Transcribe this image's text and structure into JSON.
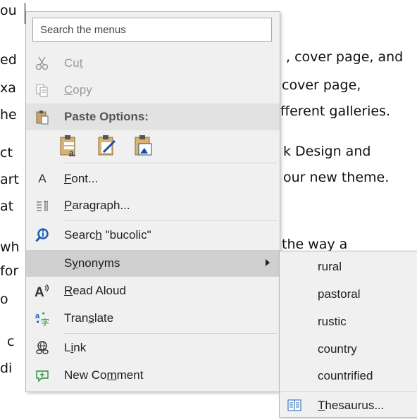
{
  "document": {
    "lines": [
      {
        "left": "|",
        "right": ""
      },
      {
        "left": "ed",
        "right": ", cover page, and"
      },
      {
        "left": "xa",
        "right": "cover page,"
      },
      {
        "left": "he",
        "right": "fferent galleries."
      },
      {
        "left": "ct",
        "right": "k Design and"
      },
      {
        "left": "art",
        "right": "our new theme."
      },
      {
        "left": "at",
        "right": ""
      },
      {
        "left": "wh",
        "right": "the way a"
      },
      {
        "left": "for",
        "right": ""
      },
      {
        "left": "o",
        "right": ""
      },
      {
        "left": "c",
        "right": ""
      },
      {
        "left": "di",
        "right": ""
      }
    ],
    "top_fragment": "ou"
  },
  "menu": {
    "search_placeholder": "Search the menus",
    "cut": {
      "pre": "Cu",
      "u": "t",
      "post": ""
    },
    "copy": {
      "pre": "",
      "u": "C",
      "post": "opy"
    },
    "paste_options": "Paste Options:",
    "font": {
      "pre": "",
      "u": "F",
      "post": "ont..."
    },
    "paragraph": {
      "pre": "",
      "u": "P",
      "post": "aragraph..."
    },
    "search": {
      "pre": "Searc",
      "u": "h",
      "post": " \"bucolic\""
    },
    "synonyms": {
      "pre": "S",
      "u": "y",
      "post": "nonyms"
    },
    "read_aloud": {
      "pre": "",
      "u": "R",
      "post": "ead Aloud"
    },
    "translate": {
      "pre": "Tran",
      "u": "s",
      "post": "late"
    },
    "link": {
      "pre": "L",
      "u": "i",
      "post": "nk"
    },
    "new_comment": {
      "pre": "New Co",
      "u": "m",
      "post": "ment"
    }
  },
  "submenu": {
    "synonyms": [
      "rural",
      "pastoral",
      "rustic",
      "country",
      "countrified"
    ],
    "thesaurus": {
      "pre": "",
      "u": "T",
      "post": "hesaurus..."
    }
  },
  "colors": {
    "menu_bg": "#f0f0f0",
    "highlight": "#cfcfcf",
    "search_icon": "#1a5fb4",
    "translate_icon": "#2e8b3e"
  }
}
